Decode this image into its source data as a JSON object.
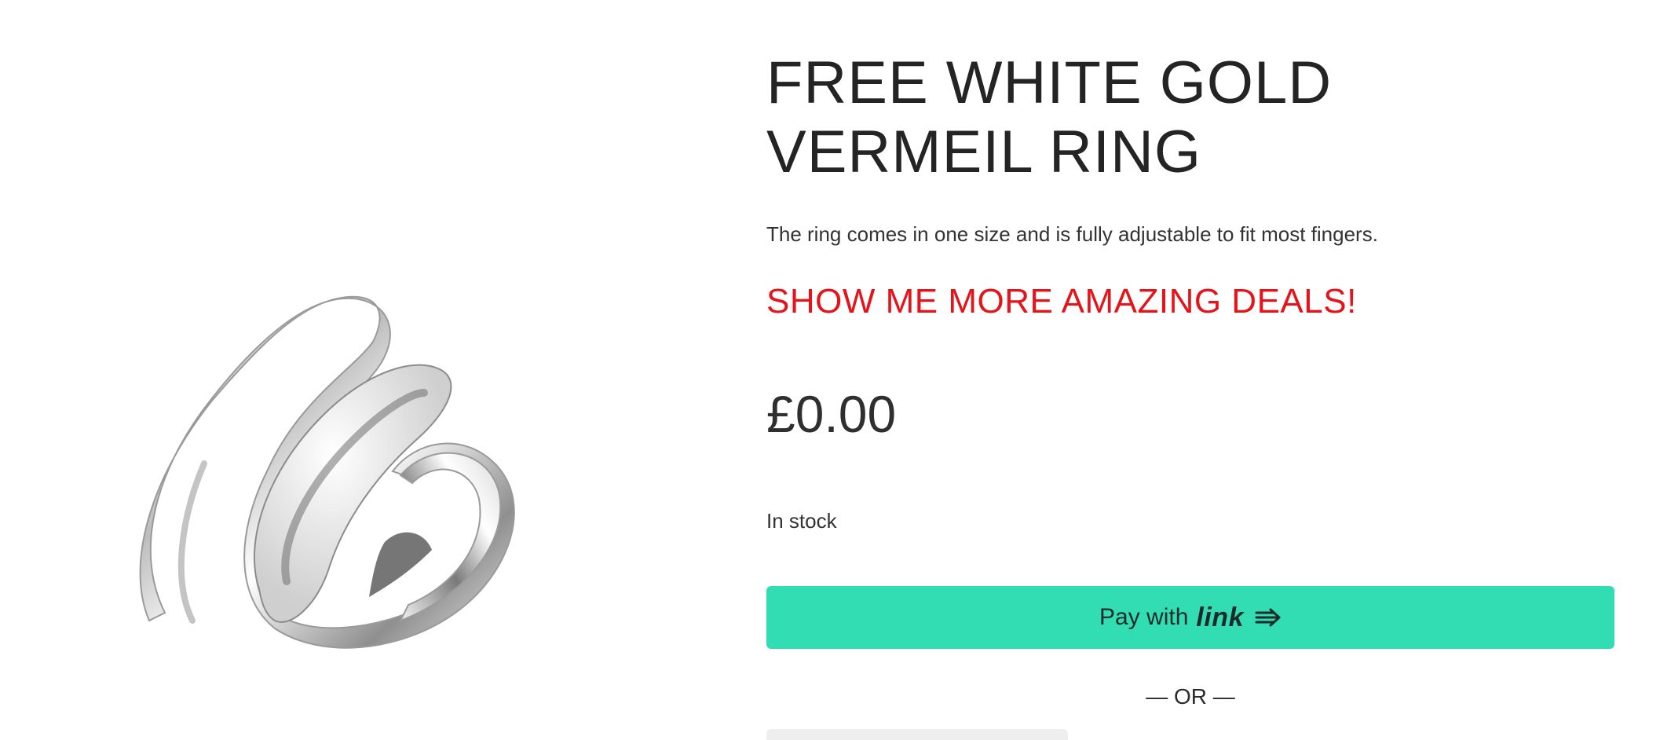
{
  "product": {
    "title": "FREE WHITE GOLD VERMEIL RING",
    "description": "The ring comes in one size and is fully adjustable to fit most fingers.",
    "deals_link": "SHOW ME MORE AMAZING DEALS!",
    "price": "£0.00",
    "stock": "In stock",
    "image_icon": "silver-wrap-ring-image"
  },
  "checkout": {
    "pay_prefix": "Pay with",
    "pay_brand": "link",
    "pay_icon": "arrow-icon",
    "button_color": "#33ddb3",
    "divider": "— OR —"
  },
  "colors": {
    "deals": "#e5141b",
    "text": "#2b2b2b"
  }
}
